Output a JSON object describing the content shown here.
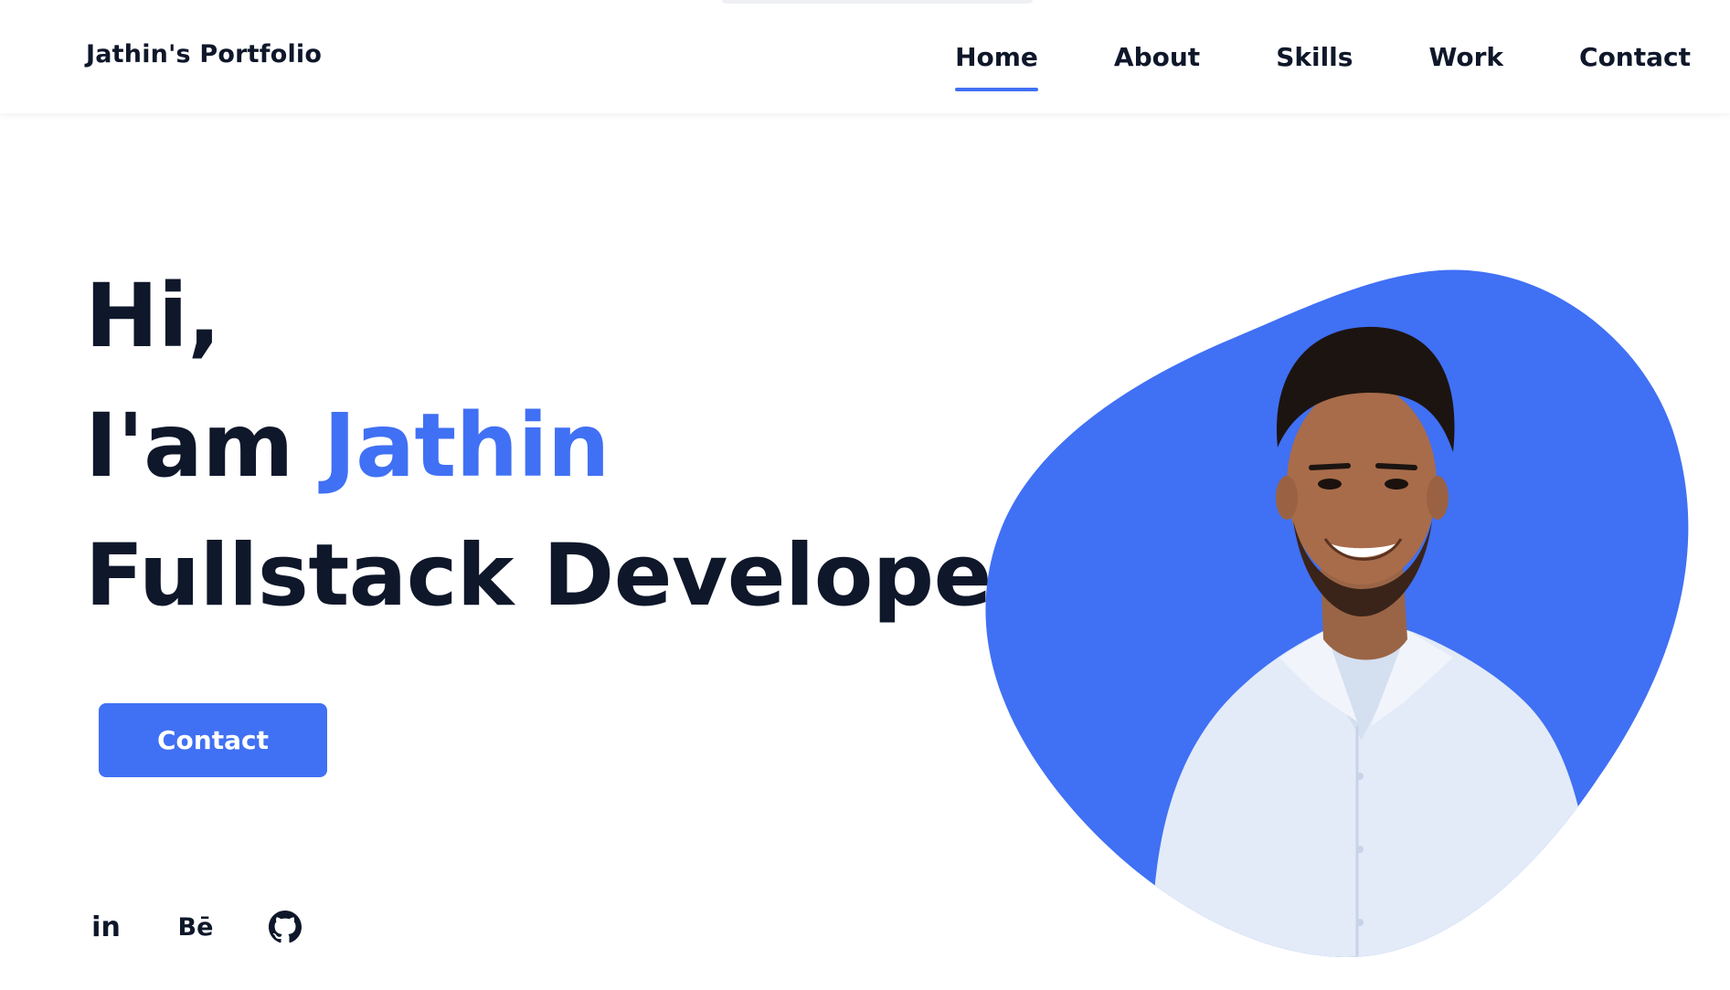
{
  "header": {
    "logo": "Jathin's Portfolio",
    "nav": [
      {
        "label": "Home",
        "active": true
      },
      {
        "label": "About",
        "active": false
      },
      {
        "label": "Skills",
        "active": false
      },
      {
        "label": "Work",
        "active": false
      },
      {
        "label": "Contact",
        "active": false
      }
    ]
  },
  "hero": {
    "greeting": "Hi,",
    "intro_prefix": "I'am",
    "name": "Jathin",
    "role": "Fullstack Developer",
    "cta_label": "Contact"
  },
  "socials": [
    {
      "icon": "linkedin-icon",
      "label": "in"
    },
    {
      "icon": "behance-icon",
      "label": "Bē"
    },
    {
      "icon": "github-icon",
      "label": ""
    }
  ],
  "colors": {
    "accent": "#4070f4",
    "text": "#0f172a",
    "background": "#ffffff"
  }
}
